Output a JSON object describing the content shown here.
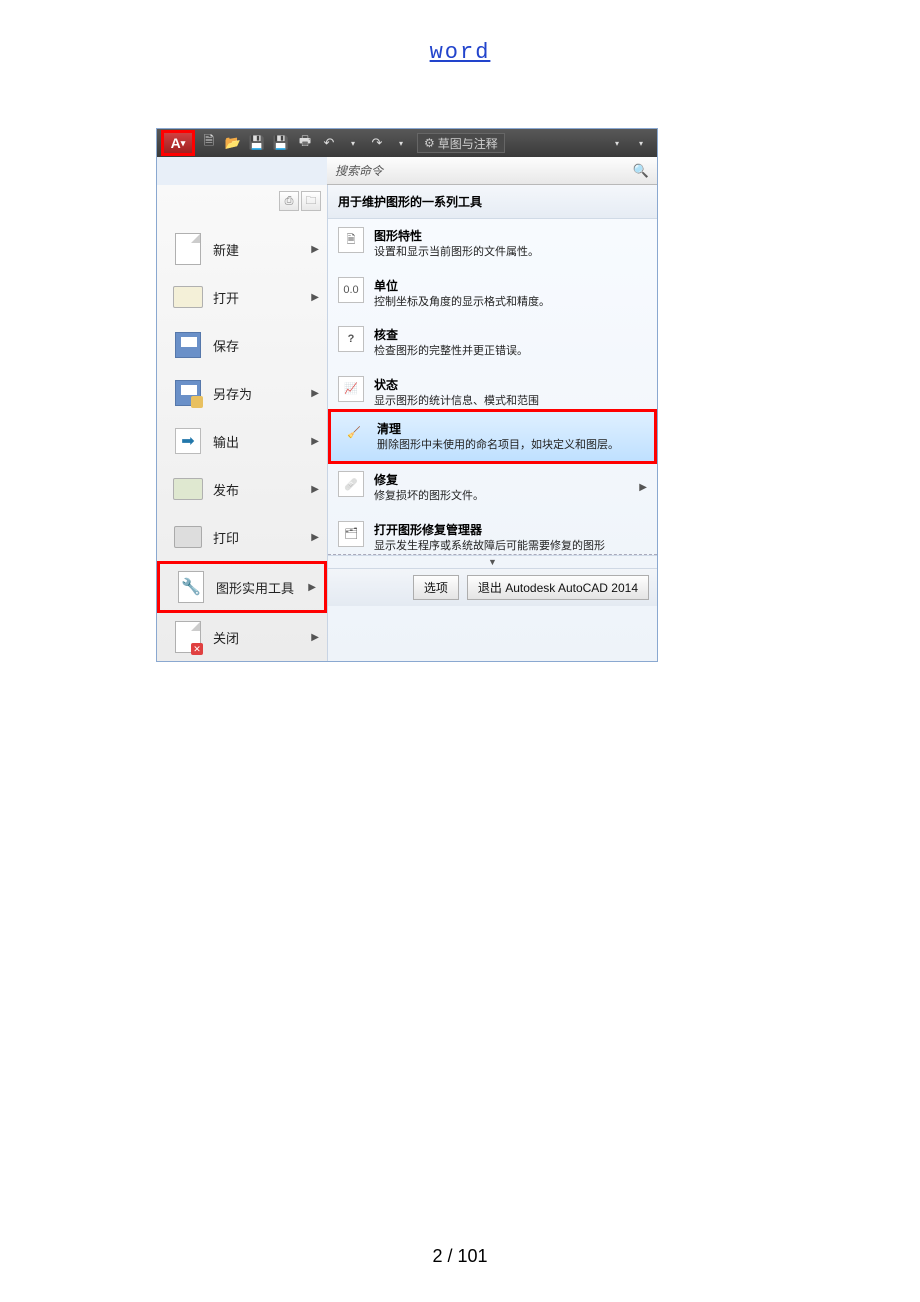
{
  "page": {
    "header_link": "word",
    "footer": "2 / 101"
  },
  "toolbar": {
    "workspace": "草图与注释"
  },
  "search": {
    "placeholder": "搜索命令"
  },
  "left": {
    "new": "新建",
    "open": "打开",
    "save": "保存",
    "saveas": "另存为",
    "export": "输出",
    "publish": "发布",
    "print": "打印",
    "utils": "图形实用工具",
    "close": "关闭"
  },
  "right": {
    "heading": "用于维护图形的一系列工具",
    "props": {
      "t": "图形特性",
      "d": "设置和显示当前图形的文件属性。"
    },
    "units": {
      "t": "单位",
      "d": "控制坐标及角度的显示格式和精度。"
    },
    "audit": {
      "t": "核查",
      "d": "检查图形的完整性并更正错误。"
    },
    "status": {
      "t": "状态",
      "d": "显示图形的统计信息、模式和范围"
    },
    "purge": {
      "t": "清理",
      "d": "删除图形中未使用的命名项目，如块定义和图层。"
    },
    "recover": {
      "t": "修复",
      "d": "修复损坏的图形文件。"
    },
    "mgr": {
      "t": "打开图形修复管理器",
      "d": "显示发生程序或系统故障后可能需要修复的图形"
    }
  },
  "footer": {
    "options": "选项",
    "exit": "退出 Autodesk AutoCAD 2014"
  }
}
